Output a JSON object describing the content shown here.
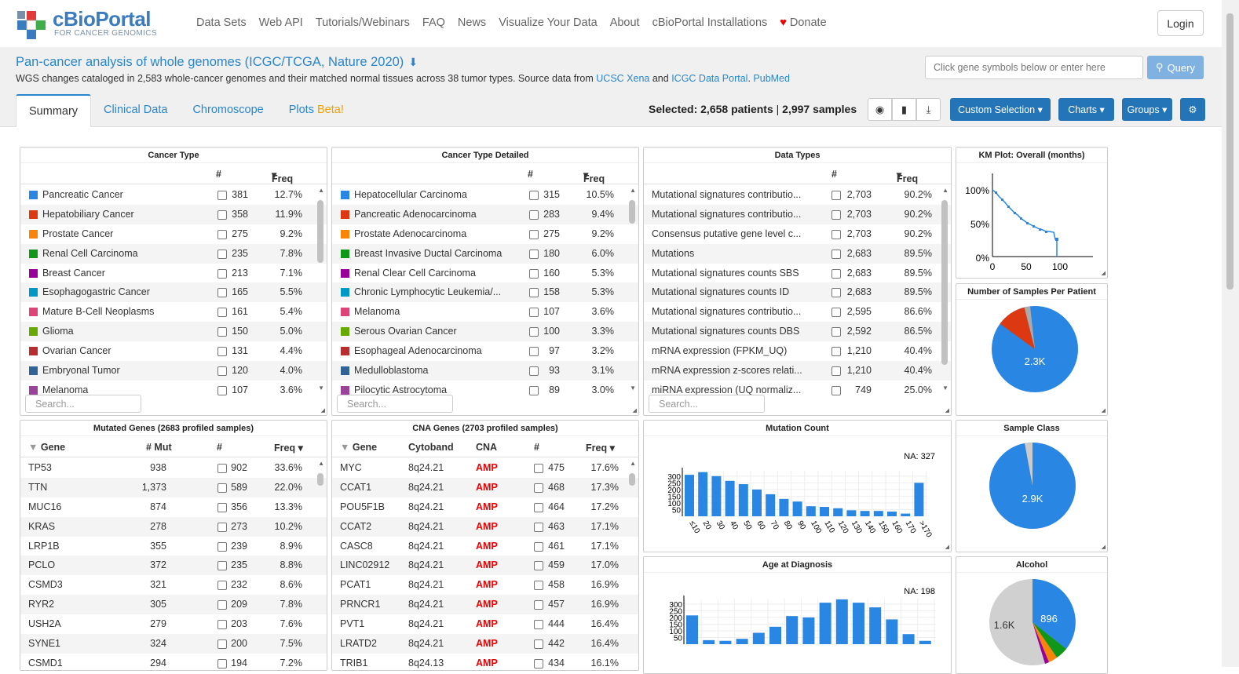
{
  "nav": {
    "logo_title": "cBioPortal",
    "logo_subtitle": "FOR CANCER GENOMICS",
    "links": [
      "Data Sets",
      "Web API",
      "Tutorials/Webinars",
      "FAQ",
      "News",
      "Visualize Your Data",
      "About",
      "cBioPortal Installations"
    ],
    "donate": "Donate",
    "login": "Login"
  },
  "study": {
    "title": "Pan-cancer analysis of whole genomes (ICGC/TCGA, Nature 2020)",
    "desc_text": "WGS changes cataloged in 2,583 whole-cancer genomes and their matched normal tissues across 38 tumor types. Source data from ",
    "link1": "UCSC Xena",
    "and": " and ",
    "link2": "ICGC Data Portal",
    "link3": "PubMed",
    "gene_placeholder": "Click gene symbols below or enter here",
    "query": "Query"
  },
  "tabs": [
    "Summary",
    "Clinical Data",
    "Chromoscope",
    "Plots"
  ],
  "tab_beta": "Beta!",
  "selected": {
    "label": "Selected:",
    "patients": "2,658 patients",
    "samples": "2,997 samples"
  },
  "toolbar": {
    "custom": "Custom Selection",
    "charts": "Charts",
    "groups": "Groups"
  },
  "cancer_type": {
    "title": "Cancer Type",
    "col_count": "#",
    "col_freq": "Freq",
    "search": "Search...",
    "rows": [
      {
        "name": "Pancreatic Cancer",
        "n": "381",
        "f": "12.7%",
        "c": "#2986e2"
      },
      {
        "name": "Hepatobiliary Cancer",
        "n": "358",
        "f": "11.9%",
        "c": "#dc3912"
      },
      {
        "name": "Prostate Cancer",
        "n": "275",
        "f": "9.2%",
        "c": "#f88508"
      },
      {
        "name": "Renal Cell Carcinoma",
        "n": "235",
        "f": "7.8%",
        "c": "#109618"
      },
      {
        "name": "Breast Cancer",
        "n": "213",
        "f": "7.1%",
        "c": "#990099"
      },
      {
        "name": "Esophagogastric Cancer",
        "n": "165",
        "f": "5.5%",
        "c": "#0099c6"
      },
      {
        "name": "Mature B-Cell Neoplasms",
        "n": "161",
        "f": "5.4%",
        "c": "#dd4477"
      },
      {
        "name": "Glioma",
        "n": "150",
        "f": "5.0%",
        "c": "#66aa00"
      },
      {
        "name": "Ovarian Cancer",
        "n": "131",
        "f": "4.4%",
        "c": "#b82e2e"
      },
      {
        "name": "Embryonal Tumor",
        "n": "120",
        "f": "4.0%",
        "c": "#316395"
      },
      {
        "name": "Melanoma",
        "n": "107",
        "f": "3.6%",
        "c": "#994499"
      }
    ]
  },
  "cancer_type_detailed": {
    "title": "Cancer Type Detailed",
    "col_count": "#",
    "col_freq": "Freq",
    "search": "Search...",
    "rows": [
      {
        "name": "Hepatocellular Carcinoma",
        "n": "315",
        "f": "10.5%",
        "c": "#2986e2"
      },
      {
        "name": "Pancreatic Adenocarcinoma",
        "n": "283",
        "f": "9.4%",
        "c": "#dc3912"
      },
      {
        "name": "Prostate Adenocarcinoma",
        "n": "275",
        "f": "9.2%",
        "c": "#f88508"
      },
      {
        "name": "Breast Invasive Ductal Carcinoma",
        "n": "180",
        "f": "6.0%",
        "c": "#109618"
      },
      {
        "name": "Renal Clear Cell Carcinoma",
        "n": "160",
        "f": "5.3%",
        "c": "#990099"
      },
      {
        "name": "Chronic Lymphocytic Leukemia/...",
        "n": "158",
        "f": "5.3%",
        "c": "#0099c6"
      },
      {
        "name": "Melanoma",
        "n": "107",
        "f": "3.6%",
        "c": "#dd4477"
      },
      {
        "name": "Serous Ovarian Cancer",
        "n": "100",
        "f": "3.3%",
        "c": "#66aa00"
      },
      {
        "name": "Esophageal Adenocarcinoma",
        "n": "97",
        "f": "3.2%",
        "c": "#b82e2e"
      },
      {
        "name": "Medulloblastoma",
        "n": "93",
        "f": "3.1%",
        "c": "#316395"
      },
      {
        "name": "Pilocytic Astrocytoma",
        "n": "89",
        "f": "3.0%",
        "c": "#994499"
      }
    ]
  },
  "data_types": {
    "title": "Data Types",
    "col_count": "#",
    "col_freq": "Freq",
    "search": "Search...",
    "rows": [
      {
        "name": "Mutational signatures contributio...",
        "n": "2,703",
        "f": "90.2%"
      },
      {
        "name": "Mutational signatures contributio...",
        "n": "2,703",
        "f": "90.2%"
      },
      {
        "name": "Consensus putative gene level c...",
        "n": "2,703",
        "f": "90.2%"
      },
      {
        "name": "Mutations",
        "n": "2,683",
        "f": "89.5%"
      },
      {
        "name": "Mutational signatures counts SBS",
        "n": "2,683",
        "f": "89.5%"
      },
      {
        "name": "Mutational signatures counts ID",
        "n": "2,683",
        "f": "89.5%"
      },
      {
        "name": "Mutational signatures contributio...",
        "n": "2,595",
        "f": "86.6%"
      },
      {
        "name": "Mutational signatures counts DBS",
        "n": "2,592",
        "f": "86.5%"
      },
      {
        "name": "mRNA expression (FPKM_UQ)",
        "n": "1,210",
        "f": "40.4%"
      },
      {
        "name": "mRNA expression z-scores relati...",
        "n": "1,210",
        "f": "40.4%"
      },
      {
        "name": "miRNA expression (UQ normaliz...",
        "n": "749",
        "f": "25.0%"
      }
    ]
  },
  "mutated_genes": {
    "title": "Mutated Genes (2683 profiled samples)",
    "cols": [
      "Gene",
      "# Mut",
      "#",
      "Freq"
    ],
    "rows": [
      {
        "g": "TP53",
        "m": "938",
        "n": "902",
        "f": "33.6%"
      },
      {
        "g": "TTN",
        "m": "1,373",
        "n": "589",
        "f": "22.0%"
      },
      {
        "g": "MUC16",
        "m": "874",
        "n": "356",
        "f": "13.3%"
      },
      {
        "g": "KRAS",
        "m": "278",
        "n": "273",
        "f": "10.2%"
      },
      {
        "g": "LRP1B",
        "m": "355",
        "n": "239",
        "f": "8.9%"
      },
      {
        "g": "PCLO",
        "m": "372",
        "n": "235",
        "f": "8.8%"
      },
      {
        "g": "CSMD3",
        "m": "321",
        "n": "232",
        "f": "8.6%"
      },
      {
        "g": "RYR2",
        "m": "305",
        "n": "209",
        "f": "7.8%"
      },
      {
        "g": "USH2A",
        "m": "279",
        "n": "203",
        "f": "7.6%"
      },
      {
        "g": "SYNE1",
        "m": "324",
        "n": "200",
        "f": "7.5%"
      },
      {
        "g": "CSMD1",
        "m": "294",
        "n": "194",
        "f": "7.2%"
      }
    ]
  },
  "cna_genes": {
    "title": "CNA Genes (2703 profiled samples)",
    "cols": [
      "Gene",
      "Cytoband",
      "CNA",
      "#",
      "Freq"
    ],
    "rows": [
      {
        "g": "MYC",
        "b": "8q24.21",
        "c": "AMP",
        "n": "475",
        "f": "17.6%"
      },
      {
        "g": "CCAT1",
        "b": "8q24.21",
        "c": "AMP",
        "n": "468",
        "f": "17.3%"
      },
      {
        "g": "POU5F1B",
        "b": "8q24.21",
        "c": "AMP",
        "n": "464",
        "f": "17.2%"
      },
      {
        "g": "CCAT2",
        "b": "8q24.21",
        "c": "AMP",
        "n": "463",
        "f": "17.1%"
      },
      {
        "g": "CASC8",
        "b": "8q24.21",
        "c": "AMP",
        "n": "461",
        "f": "17.1%"
      },
      {
        "g": "LINC02912",
        "b": "8q24.21",
        "c": "AMP",
        "n": "459",
        "f": "17.0%"
      },
      {
        "g": "PCAT1",
        "b": "8q24.21",
        "c": "AMP",
        "n": "458",
        "f": "16.9%"
      },
      {
        "g": "PRNCR1",
        "b": "8q24.21",
        "c": "AMP",
        "n": "457",
        "f": "16.9%"
      },
      {
        "g": "PVT1",
        "b": "8q24.21",
        "c": "AMP",
        "n": "444",
        "f": "16.4%"
      },
      {
        "g": "LRATD2",
        "b": "8q24.21",
        "c": "AMP",
        "n": "442",
        "f": "16.4%"
      },
      {
        "g": "TRIB1",
        "b": "8q24.13",
        "c": "AMP",
        "n": "434",
        "f": "16.1%"
      }
    ]
  },
  "km_plot": {
    "title": "KM Plot: Overall (months)",
    "yticks": [
      "100%",
      "50%",
      "0%"
    ],
    "xticks": [
      "0",
      "50",
      "100"
    ]
  },
  "samples_per_patient": {
    "title": "Number of Samples Per Patient",
    "label": "2.3K"
  },
  "sample_class": {
    "title": "Sample Class",
    "label": "2.9K"
  },
  "alcohol": {
    "title": "Alcohol",
    "label_big": "896",
    "label_grey": "1.6K"
  },
  "chart_data": [
    {
      "type": "bar",
      "title": "Mutation Count",
      "na": "NA: 327",
      "categories": [
        "≤10",
        "20",
        "30",
        "40",
        "50",
        "60",
        "70",
        "80",
        "90",
        "100",
        "110",
        "120",
        "130",
        "140",
        "150",
        "160",
        "170",
        ">170"
      ],
      "values": [
        310,
        330,
        300,
        265,
        240,
        200,
        165,
        130,
        110,
        75,
        70,
        60,
        45,
        40,
        40,
        35,
        20,
        250
      ],
      "yticks": [
        "300",
        "250",
        "200",
        "150",
        "100",
        "50"
      ],
      "ylim": [
        0,
        340
      ],
      "color": "#2986e2"
    },
    {
      "type": "bar",
      "title": "Age at Diagnosis",
      "na": "NA: 198",
      "values": [
        215,
        30,
        25,
        40,
        85,
        130,
        210,
        200,
        310,
        335,
        310,
        275,
        185,
        75,
        25
      ],
      "yticks": [
        "300",
        "250",
        "200",
        "150",
        "100",
        "50"
      ],
      "ylim": [
        0,
        340
      ],
      "color": "#2986e2"
    }
  ]
}
